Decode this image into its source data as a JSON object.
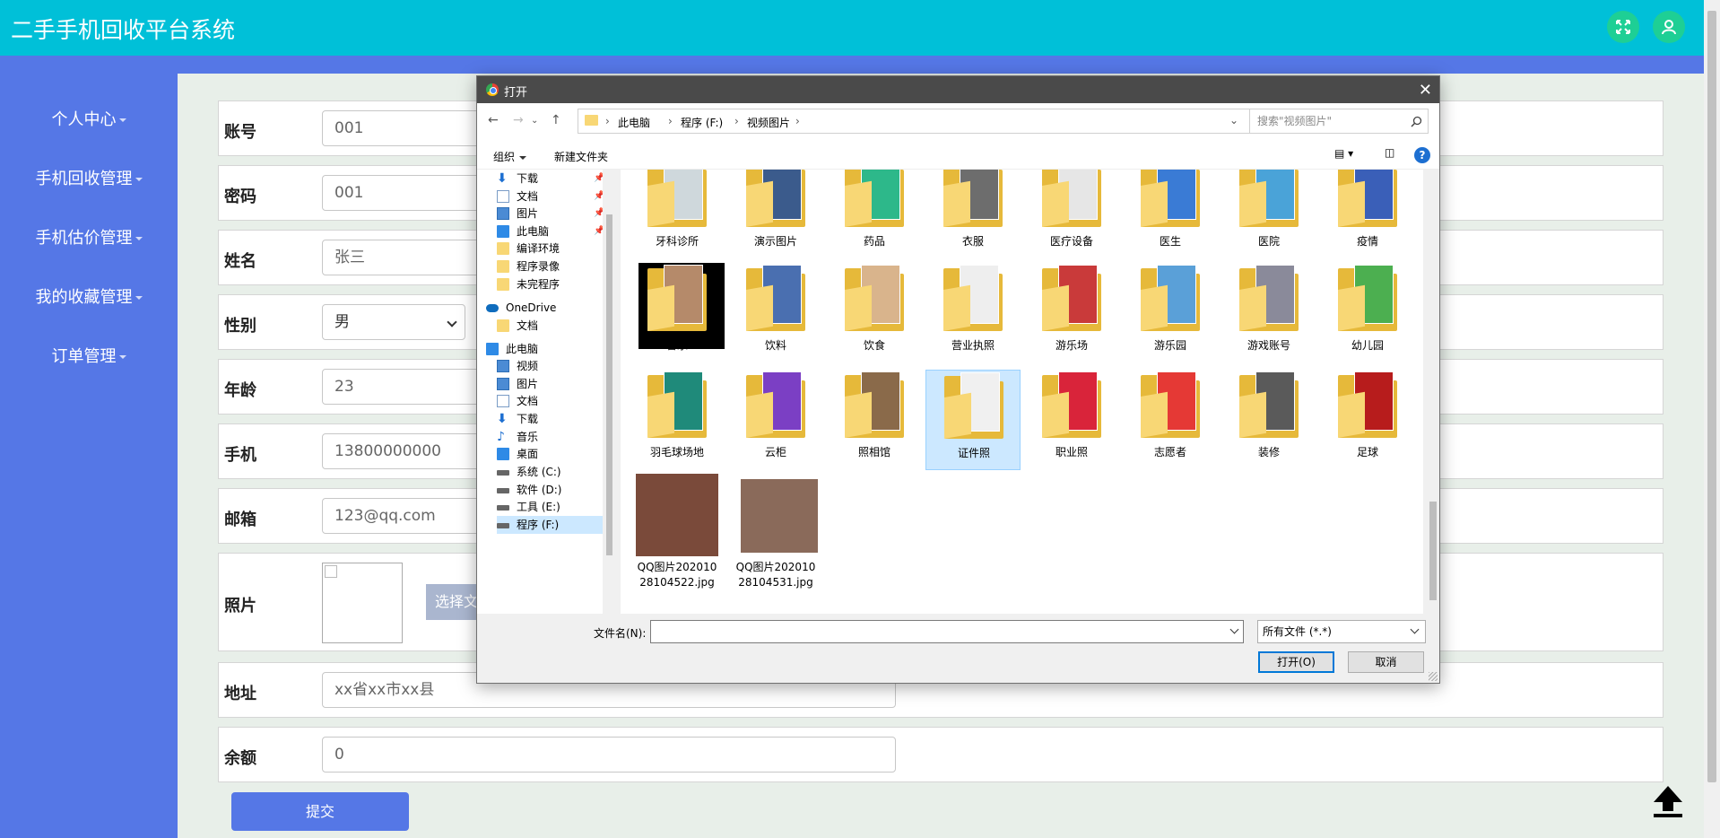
{
  "app": {
    "title": "二手手机回收平台系统"
  },
  "sidebar": {
    "items": [
      {
        "label": "个人中心"
      },
      {
        "label": "手机回收管理"
      },
      {
        "label": "手机估价管理"
      },
      {
        "label": "我的收藏管理"
      },
      {
        "label": "订单管理"
      }
    ]
  },
  "form": {
    "account": {
      "label": "账号",
      "value": "001"
    },
    "password": {
      "label": "密码",
      "value": "001"
    },
    "name": {
      "label": "姓名",
      "value": "张三"
    },
    "gender": {
      "label": "性别",
      "value": "男"
    },
    "age": {
      "label": "年龄",
      "value": "23"
    },
    "phone": {
      "label": "手机",
      "value": "13800000000"
    },
    "email": {
      "label": "邮箱",
      "value": "123@qq.com"
    },
    "photo": {
      "label": "照片",
      "choose_label": "选择文"
    },
    "address": {
      "label": "地址",
      "value": "xx省xx市xx县"
    },
    "balance": {
      "label": "余额",
      "value": "0"
    },
    "submit_label": "提交"
  },
  "dialog": {
    "title": "打开",
    "close_glyph": "✕",
    "breadcrumb": [
      "此电脑",
      "程序 (F:)",
      "视频图片"
    ],
    "search_placeholder": "搜索\"视频图片\"",
    "organize_label": "组织",
    "new_folder_label": "新建文件夹",
    "help_glyph": "?",
    "nav_items": [
      {
        "label": "下载",
        "icon": "download-icon",
        "pinned": true
      },
      {
        "label": "文档",
        "icon": "document-icon",
        "pinned": true
      },
      {
        "label": "图片",
        "icon": "pictures-icon",
        "pinned": true
      },
      {
        "label": "此电脑",
        "icon": "computer-icon",
        "pinned": true
      },
      {
        "label": "编译环境",
        "icon": "folder-icon",
        "pinned": false
      },
      {
        "label": "程序录像",
        "icon": "folder-icon",
        "pinned": false
      },
      {
        "label": "未完程序",
        "icon": "folder-icon",
        "pinned": false
      },
      {
        "label": "OneDrive",
        "icon": "onedrive-icon",
        "pinned": false
      },
      {
        "label": "文档",
        "icon": "folder-icon",
        "pinned": false
      },
      {
        "label": "此电脑",
        "icon": "computer-icon",
        "pinned": false
      },
      {
        "label": "视频",
        "icon": "videos-icon",
        "pinned": false
      },
      {
        "label": "图片",
        "icon": "pictures-icon",
        "pinned": false
      },
      {
        "label": "文档",
        "icon": "document-icon",
        "pinned": false
      },
      {
        "label": "下载",
        "icon": "download-icon",
        "pinned": false
      },
      {
        "label": "音乐",
        "icon": "music-icon",
        "pinned": false
      },
      {
        "label": "桌面",
        "icon": "desktop-icon",
        "pinned": false
      },
      {
        "label": "系统 (C:)",
        "icon": "drive-icon",
        "pinned": false
      },
      {
        "label": "软件 (D:)",
        "icon": "drive-icon",
        "pinned": false
      },
      {
        "label": "工具 (E:)",
        "icon": "drive-icon",
        "pinned": false
      },
      {
        "label": "程序 (F:)",
        "icon": "drive-icon",
        "pinned": false
      }
    ],
    "folders": [
      {
        "label": "牙科诊所",
        "color": "#cfd8dc"
      },
      {
        "label": "演示图片",
        "color": "#3b5b8c"
      },
      {
        "label": "药品",
        "color": "#2db88a"
      },
      {
        "label": "衣服",
        "color": "#6d6d6d"
      },
      {
        "label": "医疗设备",
        "color": "#e6e6e6"
      },
      {
        "label": "医生",
        "color": "#3a7bd5"
      },
      {
        "label": "医院",
        "color": "#4aa3d8"
      },
      {
        "label": "疫情",
        "color": "#3a5fb8"
      },
      {
        "label": "音乐",
        "color": "#b58a6a"
      },
      {
        "label": "饮料",
        "color": "#4a6fb0"
      },
      {
        "label": "饮食",
        "color": "#d9b48c"
      },
      {
        "label": "营业执照",
        "color": "#eeeeee"
      },
      {
        "label": "游乐场",
        "color": "#c93a3a"
      },
      {
        "label": "游乐园",
        "color": "#5aa0d8"
      },
      {
        "label": "游戏账号",
        "color": "#8a8a9a"
      },
      {
        "label": "幼儿园",
        "color": "#4caf50"
      },
      {
        "label": "羽毛球场地",
        "color": "#1f8a7a"
      },
      {
        "label": "云柜",
        "color": "#7b3fc4"
      },
      {
        "label": "照相馆",
        "color": "#8a6a4a"
      },
      {
        "label": "证件照",
        "color": "#f0f0f0"
      },
      {
        "label": "职业照",
        "color": "#d9243a"
      },
      {
        "label": "志愿者",
        "color": "#e53935"
      },
      {
        "label": "装修",
        "color": "#5a5a5a"
      },
      {
        "label": "足球",
        "color": "#b71c1c"
      }
    ],
    "images": [
      {
        "label": "QQ图片20201028104522.jpg",
        "color": "#7a4a3a"
      },
      {
        "label": "QQ图片20201028104531.jpg",
        "color": "#8a6a5a"
      }
    ],
    "filename_label": "文件名(N):",
    "filename_value": "",
    "filetype_value": "所有文件 (*.*)",
    "open_label": "打开(O)",
    "cancel_label": "取消"
  },
  "colors": {
    "header": "#00c0d8",
    "sidebar": "#5577e6",
    "header_button": "#1ecf95",
    "dialog_title": "#4a4a4a",
    "selection": "#cce8ff"
  }
}
